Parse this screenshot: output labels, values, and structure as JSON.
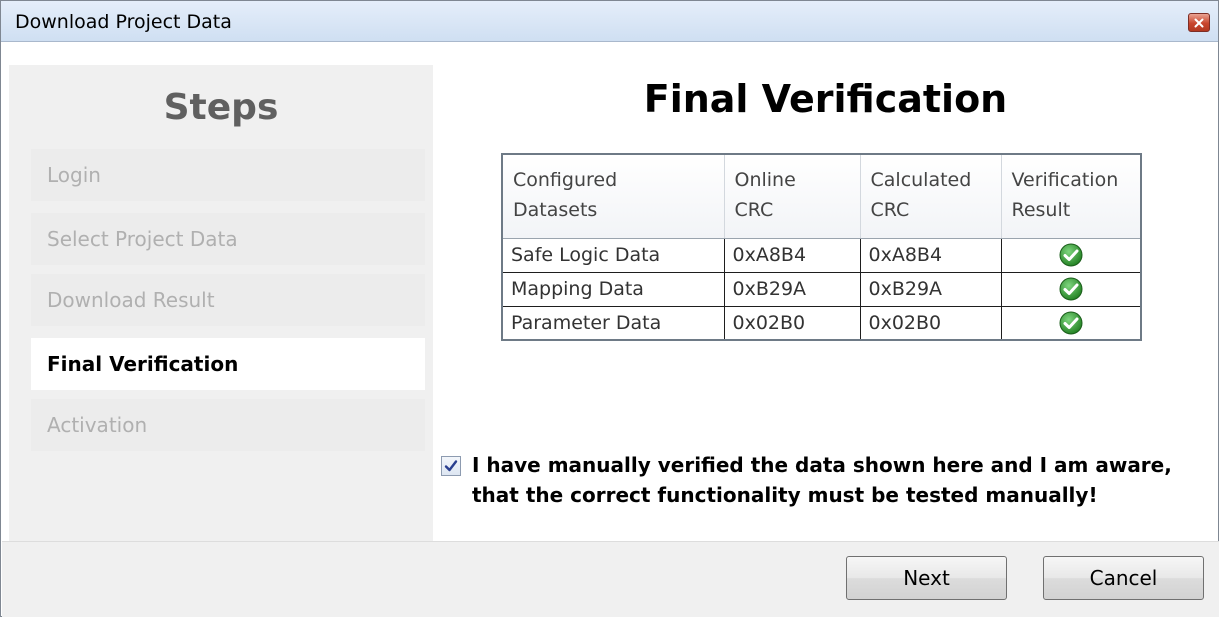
{
  "window": {
    "title": "Download Project Data"
  },
  "sidebar": {
    "heading": "Steps",
    "steps": [
      {
        "label": "Login",
        "state": "inactive"
      },
      {
        "label": "Select Project Data",
        "state": "inactive"
      },
      {
        "label": "Download Result",
        "state": "inactive"
      },
      {
        "label": "Final Verification",
        "state": "active"
      },
      {
        "label": "Activation",
        "state": "inactive"
      }
    ]
  },
  "main": {
    "title": "Final Verification",
    "table": {
      "headers": [
        [
          "Configured",
          "Datasets"
        ],
        [
          "Online",
          "CRC"
        ],
        [
          "Calculated",
          "CRC"
        ],
        [
          "Verification",
          "Result"
        ]
      ],
      "rows": [
        {
          "dataset": "Safe Logic Data",
          "online": "0xA8B4",
          "calculated": "0xA8B4",
          "result_icon": "check-circle-icon"
        },
        {
          "dataset": "Mapping Data",
          "online": "0xB29A",
          "calculated": "0xB29A",
          "result_icon": "check-circle-icon"
        },
        {
          "dataset": "Parameter Data",
          "online": "0x02B0",
          "calculated": "0x02B0",
          "result_icon": "check-circle-icon"
        }
      ]
    },
    "confirmation": {
      "checked": true,
      "line1": "I have manually verified the data shown here and I am aware,",
      "line2": "that the correct functionality must be tested manually!"
    }
  },
  "footer": {
    "next_label": "Next",
    "cancel_label": "Cancel"
  },
  "colors": {
    "check_green": "#2f9a2f",
    "active_step_bg": "#ffffff",
    "inactive_step_text": "#b0b0b0"
  }
}
